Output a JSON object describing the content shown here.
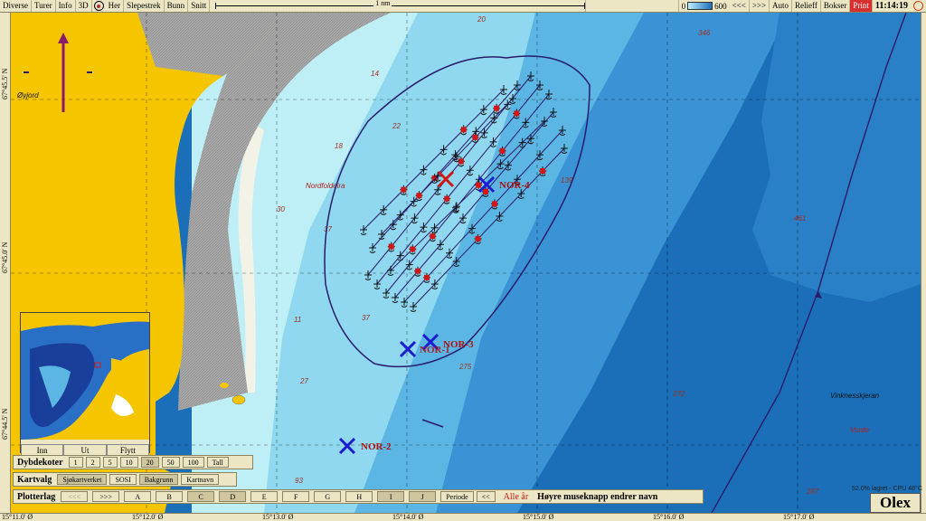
{
  "toolbar": {
    "menu": [
      "Diverse",
      "Turer",
      "Info",
      "3D"
    ],
    "menu2": [
      "Her",
      "Slepestrek",
      "Bunn",
      "Snitt"
    ],
    "scale_label": "1 nm",
    "depth_min": "0",
    "depth_max": "600",
    "nav_back": "<<<",
    "nav_fwd": ">>>",
    "auto": "Auto",
    "relieff": "Relieff",
    "bokser": "Bokser",
    "print": "Print",
    "time": "11:14:19"
  },
  "lat_labels": [
    "67°45.5' N",
    "67°45.0' N",
    "67°44.5' N"
  ],
  "lon_labels": [
    "15°11.0' Ø",
    "15°12.0' Ø",
    "15°13.0' Ø",
    "15°14.0' Ø",
    "15°15.0' Ø",
    "15°16.0' Ø",
    "15°17.0' Ø"
  ],
  "place_names": {
    "oyjord": "Øyjord",
    "nordfolddjupet": "Nordfoldeira",
    "vinknesskjeran": "Vinknesskjeran",
    "vorde": "Vorde"
  },
  "depth_soundings": [
    "20",
    "14",
    "18",
    "22",
    "30",
    "37",
    "37",
    "11",
    "27",
    "93",
    "139",
    "275",
    "272",
    "287",
    "346",
    "461"
  ],
  "markers": [
    {
      "label": "NOR-4"
    },
    {
      "label": "NOR-3"
    },
    {
      "label": "NOR-1"
    },
    {
      "label": "NOR-2"
    }
  ],
  "minimap": {
    "buttons": [
      "Inn",
      "Ut",
      "Flytt"
    ]
  },
  "dybdekoter": {
    "title": "Dybdekoter",
    "options": [
      "1",
      "2",
      "5",
      "10",
      "20",
      "50",
      "100",
      "Tall"
    ],
    "selected": "20"
  },
  "kartvalg": {
    "title": "Kartvalg",
    "options": [
      "Sjøkartverket",
      "SOSI",
      "Bakgrunn",
      "Kartnavn"
    ]
  },
  "plotterlag": {
    "title": "Plotterlag",
    "back": "<<<",
    "fwd": ">>>",
    "layers": [
      "A",
      "B",
      "C",
      "D",
      "E",
      "F",
      "G",
      "H",
      "I",
      "J"
    ],
    "selected_layers": [
      "C",
      "D",
      "I",
      "J"
    ],
    "periode": "Periode",
    "prev": "<<",
    "alle_ar": "Alle år",
    "hint": "Høyre museknapp endrer navn"
  },
  "status_text": "52.0% lagret - CPU 48°C",
  "brand": "Olex",
  "colors": {
    "land": "#f5c600",
    "shallow": "#bfeff6",
    "deep": "#1a6fb8",
    "track": "#2a1a6a",
    "marker": "#1c1ccf",
    "red_marker": "#d01818"
  }
}
